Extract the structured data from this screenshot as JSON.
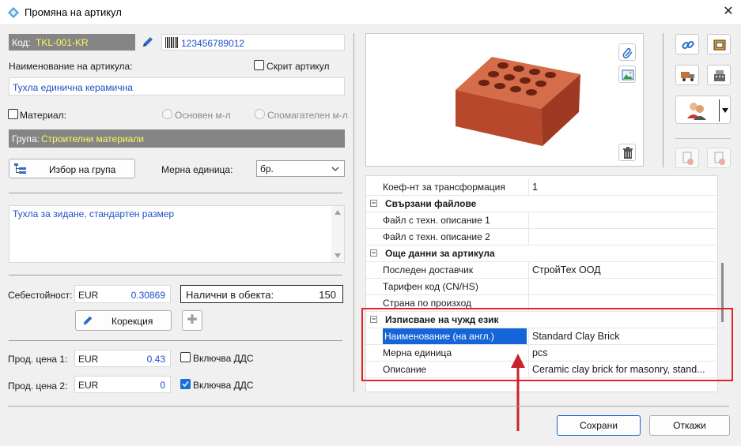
{
  "window": {
    "title": "Промяна на артикул",
    "close": "✕"
  },
  "article": {
    "code_label": "Код:",
    "code_value": "TKL-001-KR",
    "barcode_value": "123456789012",
    "name_label": "Наименование на артикула:",
    "name_value": "Тухла единична керамична",
    "hidden_label": "Скрит артикул",
    "material_label": "Материал:",
    "main_material_label": "Основен м-л",
    "aux_material_label": "Спомагателен м-л",
    "group_label": "Група:",
    "group_value": "Строителни материали",
    "select_group_button": "Избор на група",
    "unit_label": "Мерна единица:",
    "unit_value": "бр.",
    "description": "Тухла за зидане, стандартен размер"
  },
  "pricing": {
    "cost_label": "Себестойност:",
    "cost_currency": "EUR",
    "cost_value": "0.30869",
    "stock_label": "Налични в обекта:",
    "stock_value": "150",
    "correction_button": "Корекция",
    "plus_symbol": "✚",
    "price1_label": "Прод. цена 1:",
    "price1_currency": "EUR",
    "price1_value": "0.43",
    "price2_label": "Прод. цена 2:",
    "price2_currency": "EUR",
    "price2_value": "0",
    "vat_label1": "Включва ДДС",
    "vat_label2": "Включва ДДС",
    "vat1_checked": false,
    "vat2_checked": true
  },
  "properties": {
    "rows": [
      {
        "type": "row",
        "name": "Коеф-нт за трансформация",
        "value": "1"
      },
      {
        "type": "cat",
        "name": "Свързани файлове",
        "expand": "−"
      },
      {
        "type": "row",
        "name": "Файл с техн. описание 1",
        "value": ""
      },
      {
        "type": "row",
        "name": "Файл с техн. описание 2",
        "value": ""
      },
      {
        "type": "cat",
        "name": "Още данни за артикула",
        "expand": "−"
      },
      {
        "type": "row",
        "name": "Последен доставчик",
        "value": "СтройТех ООД"
      },
      {
        "type": "row",
        "name": "Тарифен код (CN/HS)",
        "value": ""
      },
      {
        "type": "row",
        "name": "Страна по произход",
        "value": ""
      },
      {
        "type": "cat",
        "name": "Изписване на чужд език",
        "expand": "−"
      },
      {
        "type": "sel",
        "name": "Наименование (на англ.)",
        "value": "Standard Clay Brick"
      },
      {
        "type": "row",
        "name": "Мерна единица",
        "value": "pcs"
      },
      {
        "type": "row",
        "name": "Описание",
        "value": "Ceramic clay brick for masonry, stand..."
      }
    ]
  },
  "buttons": {
    "save": "Сохрани",
    "cancel": "Откажи"
  },
  "colors": {
    "accent": "#1565d8",
    "highlight_box": "#e0242a",
    "arrow": "#c8232a",
    "group_text": "#fff65e"
  },
  "icons": [
    "diamond-app-icon",
    "pencil-icon",
    "barcode-icon",
    "paperclip-icon",
    "image-icon",
    "trash-icon",
    "link-icon",
    "printer-icon",
    "truck-icon",
    "cash-register-icon",
    "users-icon",
    "doc1-icon",
    "doc2-icon",
    "plus-icon",
    "tree-group-icon"
  ]
}
